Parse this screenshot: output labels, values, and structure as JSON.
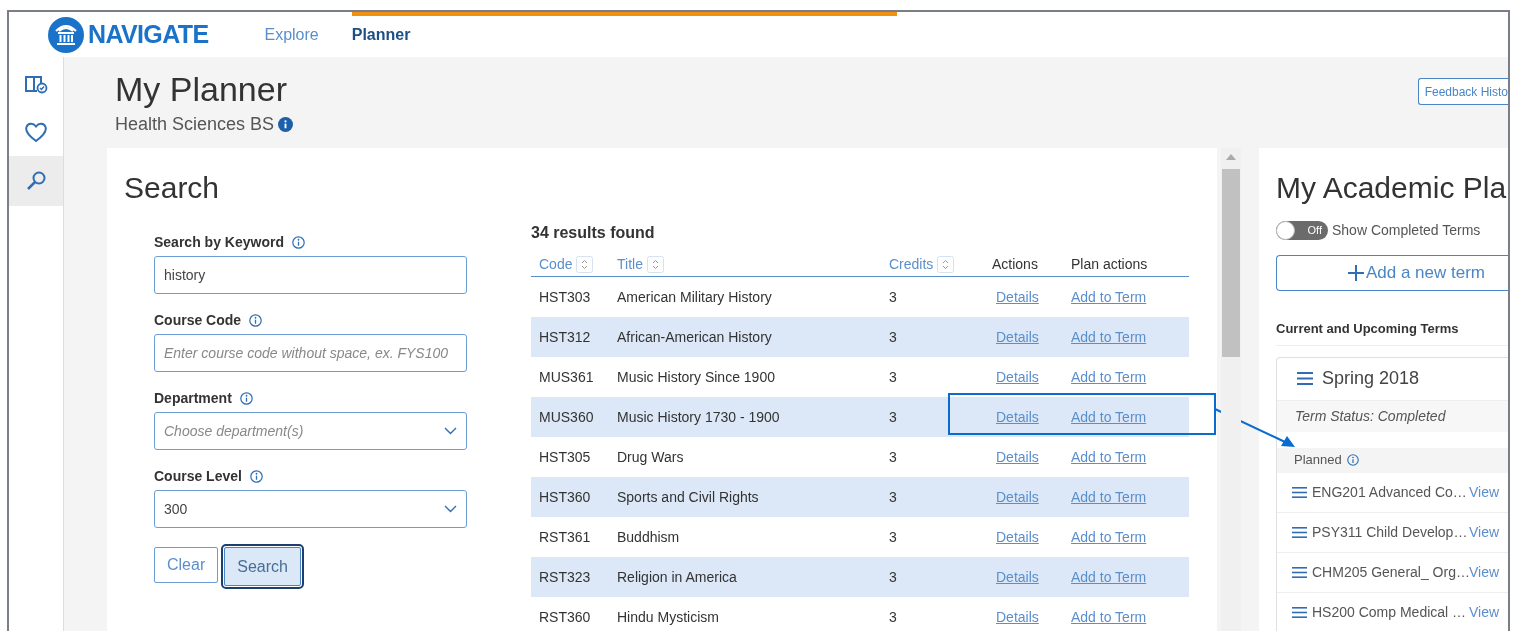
{
  "brand": "NAVIGATE",
  "nav": [
    {
      "label": "Explore",
      "selected": false
    },
    {
      "label": "Planner",
      "selected": true
    }
  ],
  "sidebar": [
    {
      "kind": "book",
      "selected": false
    },
    {
      "kind": "heart",
      "selected": false
    },
    {
      "kind": "search",
      "selected": true
    }
  ],
  "page_title": "My Planner",
  "subtitle": "Health Sciences BS",
  "feedback_button": "Feedback Histo",
  "search_panel": {
    "title": "Search",
    "fields": [
      {
        "kind": "text",
        "label": "Search by Keyword",
        "value": "history"
      },
      {
        "kind": "text",
        "label": "Course Code",
        "placeholder": "Enter course code without space, ex. FYS100"
      },
      {
        "kind": "select",
        "label": "Department",
        "placeholder": "Choose department(s)"
      },
      {
        "kind": "select",
        "label": "Course Level",
        "value": "300"
      }
    ],
    "buttons": [
      {
        "label": "Clear",
        "selected": false
      },
      {
        "label": "Search",
        "selected": true
      }
    ]
  },
  "results": {
    "count": "34 results found",
    "columns": [
      {
        "label": "Code",
        "sortable": true
      },
      {
        "label": "Title",
        "sortable": true
      },
      {
        "label": "Credits",
        "sortable": true
      },
      {
        "label": "Actions",
        "sortable": false
      },
      {
        "label": "Plan actions",
        "sortable": false
      }
    ],
    "rows": [
      {
        "code": "HST303",
        "title": "American Military History",
        "credits": "3",
        "details": "Details",
        "plan": "Add to Term",
        "callout": false
      },
      {
        "code": "HST312",
        "title": "African-American History",
        "credits": "3",
        "details": "Details",
        "plan": "Add to Term",
        "callout": false
      },
      {
        "code": "MUS361",
        "title": "Music History Since 1900",
        "credits": "3",
        "details": "Details",
        "plan": "Add to Term",
        "callout": false
      },
      {
        "code": "MUS360",
        "title": "Music History 1730 - 1900",
        "credits": "3",
        "details": "Details",
        "plan": "Add to Term",
        "callout": true
      },
      {
        "code": "HST305",
        "title": "Drug Wars",
        "credits": "3",
        "details": "Details",
        "plan": "Add to Term",
        "callout": false
      },
      {
        "code": "HST360",
        "title": "Sports and Civil Rights",
        "credits": "3",
        "details": "Details",
        "plan": "Add to Term",
        "callout": false
      },
      {
        "code": "RST361",
        "title": "Buddhism",
        "credits": "3",
        "details": "Details",
        "plan": "Add to Term",
        "callout": false
      },
      {
        "code": "RST323",
        "title": "Religion in America",
        "credits": "3",
        "details": "Details",
        "plan": "Add to Term",
        "callout": false
      },
      {
        "code": "RST360",
        "title": "Hindu Mysticism",
        "credits": "3",
        "details": "Details",
        "plan": "Add to Term",
        "callout": false
      }
    ]
  },
  "plan_panel": {
    "title": "My Academic Pla",
    "toggle": {
      "on": false,
      "state_label": "Off",
      "label": "Show Completed Terms"
    },
    "add_button": "Add a new term",
    "section": "Current and Upcoming Terms",
    "term": {
      "name": "Spring 2018",
      "status": "Term Status: Completed",
      "group": "Planned",
      "courses": [
        {
          "name": "ENG201 Advanced Co…",
          "link": "View"
        },
        {
          "name": "PSY311 Child Develop…",
          "link": "View"
        },
        {
          "name": "CHM205 General_ Org…",
          "link": "View"
        },
        {
          "name": "HS200 Comp Medical …",
          "link": "View"
        }
      ]
    }
  }
}
